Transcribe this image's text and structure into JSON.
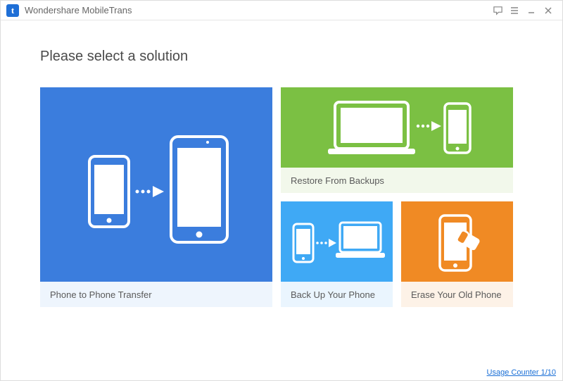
{
  "app": {
    "title": "Wondershare MobileTrans",
    "logo_letter": "t"
  },
  "heading": "Please select a solution",
  "tiles": {
    "phone_transfer": "Phone to Phone Transfer",
    "restore": "Restore From Backups",
    "backup": "Back Up Your Phone",
    "erase": "Erase Your Old Phone"
  },
  "footer": {
    "usage_counter": "Usage Counter 1/10"
  }
}
